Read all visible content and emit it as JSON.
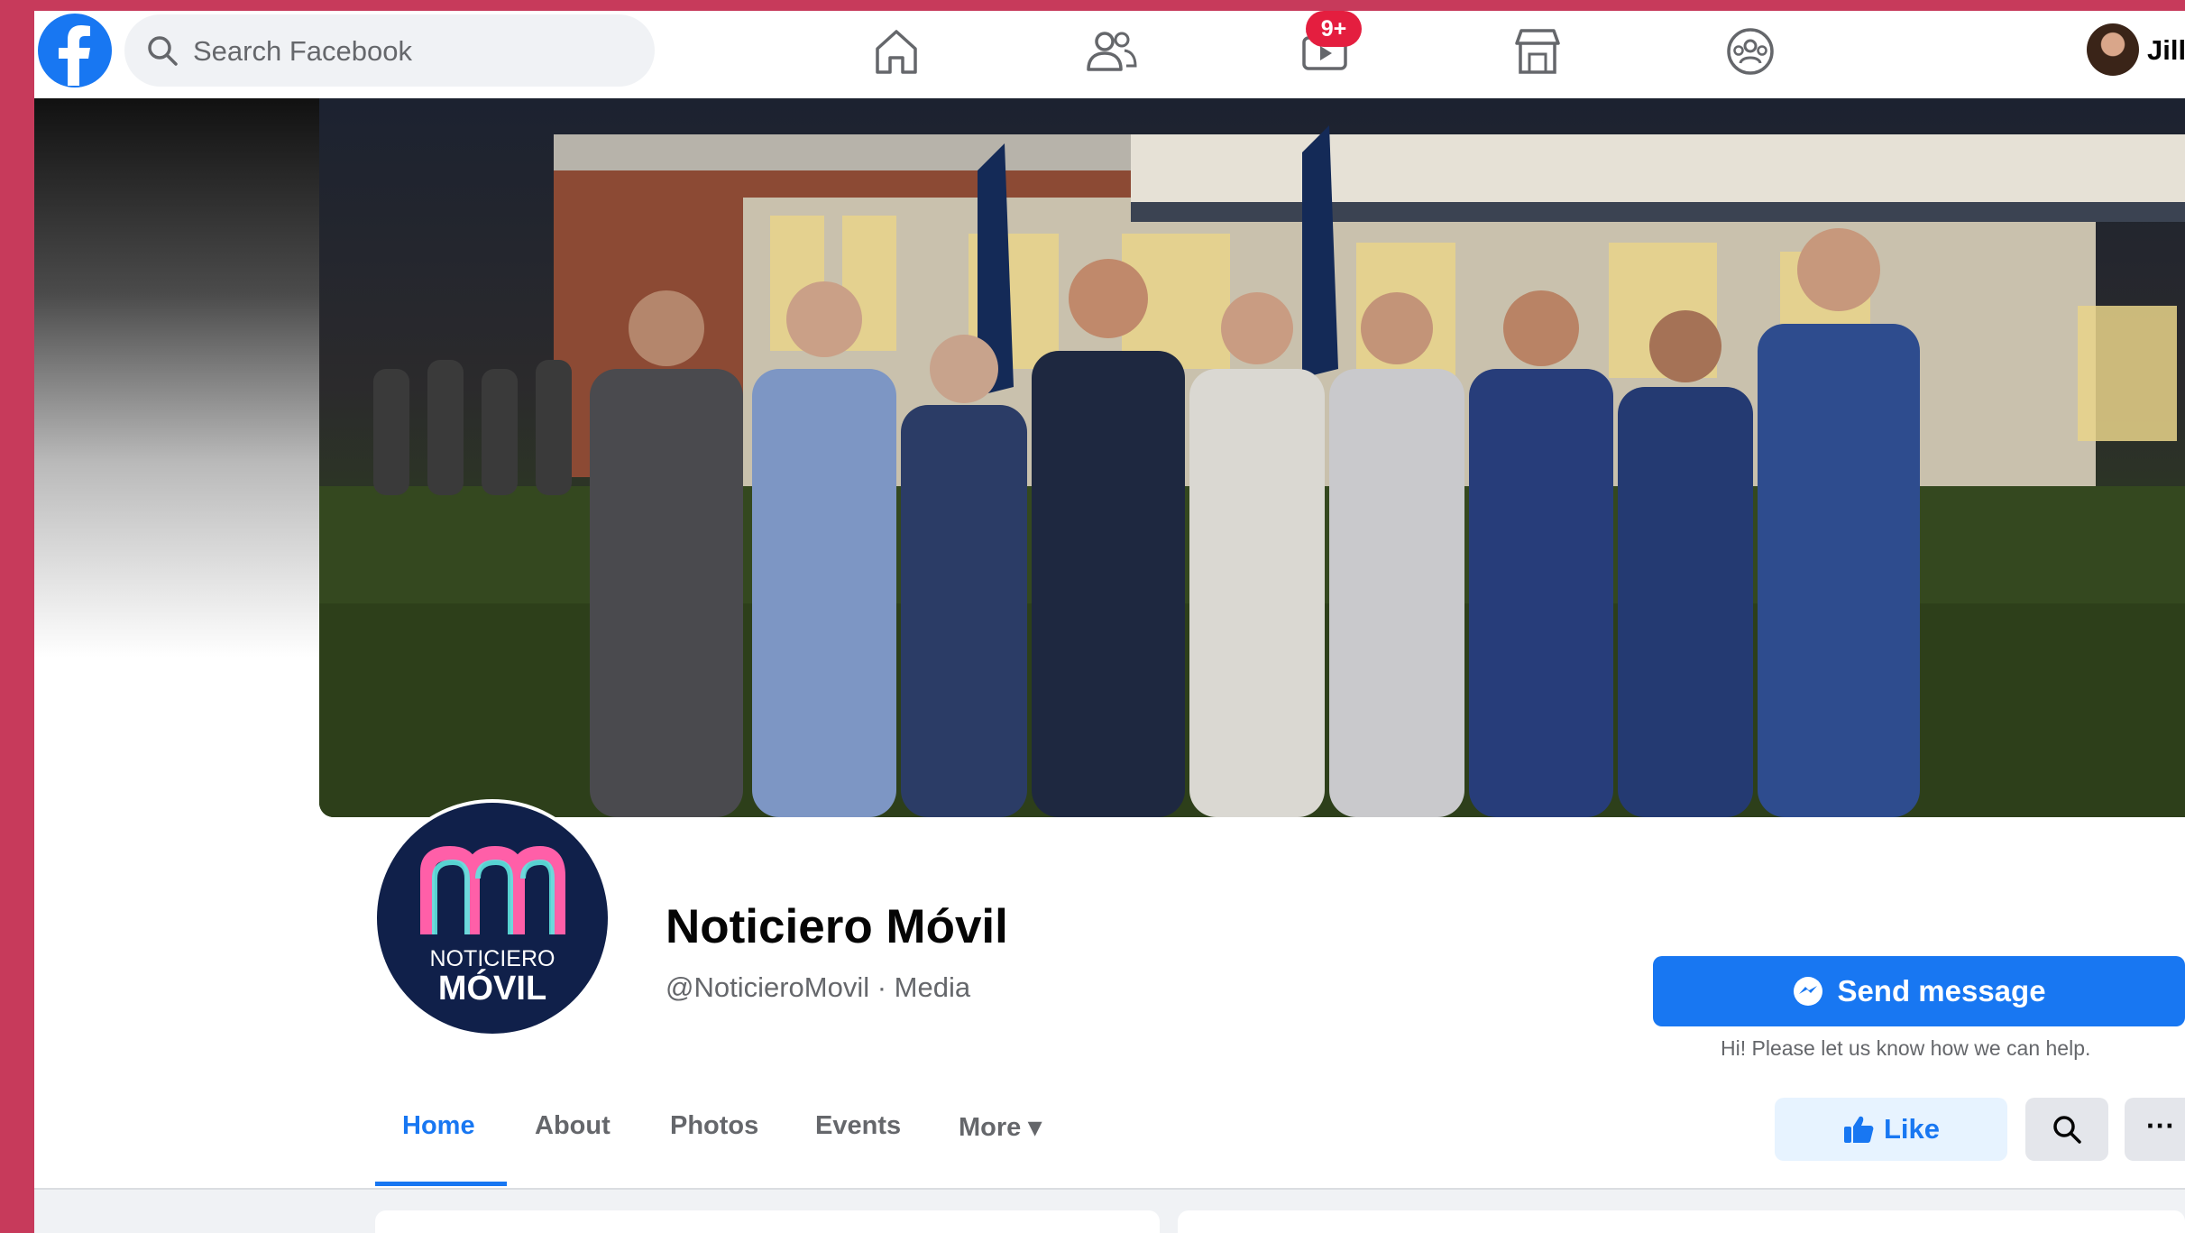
{
  "topbar": {
    "search": {
      "placeholder": "Search Facebook"
    },
    "nav": [
      {
        "name": "home-icon"
      },
      {
        "name": "friends-icon"
      },
      {
        "name": "watch-icon",
        "badge": "9+"
      },
      {
        "name": "marketplace-icon"
      },
      {
        "name": "groups-icon"
      }
    ],
    "user": {
      "name": "Jill"
    }
  },
  "profile": {
    "logo_text": {
      "top": "NOTICIERO",
      "bottom": "MÓVIL"
    },
    "name": "Noticiero Móvil",
    "handle": "@NoticieroMovil · Media",
    "send_message_label": "Send message",
    "send_message_hint": "Hi! Please let us know how we can help."
  },
  "tabs": [
    {
      "label": "Home",
      "active": true
    },
    {
      "label": "About"
    },
    {
      "label": "Photos"
    },
    {
      "label": "Events"
    },
    {
      "label": "More ▾"
    }
  ],
  "actions": {
    "like_label": "Like",
    "more_label": "···"
  },
  "colors": {
    "facebook_blue": "#1877f2",
    "notification_red": "#e41e3f",
    "screen_border": "#c73a5b",
    "logo_navy": "#10204a"
  }
}
